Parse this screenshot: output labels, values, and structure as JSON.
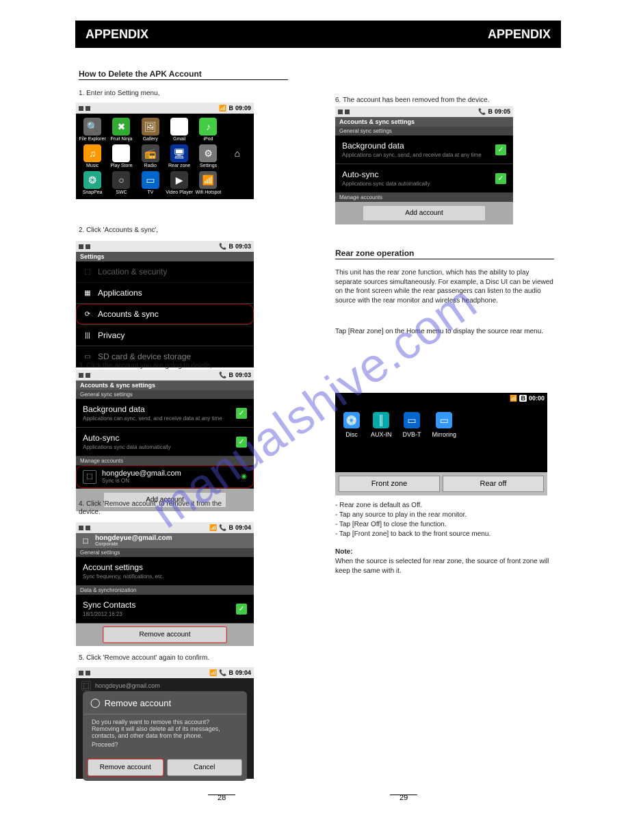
{
  "header": {
    "left_label": "APPENDIX",
    "right_label": "APPENDIX"
  },
  "section1": {
    "title": "How to Delete the APK Account",
    "step1": "1. Enter into Setting menu,"
  },
  "watermark": "manualshive.com",
  "status": {
    "time1": "09:09",
    "time2": "09:03",
    "time3": "09:03",
    "time4": "09:04",
    "time5": "09:04",
    "time6": "09:05",
    "time7": "00:00",
    "bt": "B"
  },
  "apps": [
    {
      "name": "file-explorer",
      "label": "File Explorer",
      "bg": "#666",
      "glyph": "🔍"
    },
    {
      "name": "fruit-ninja",
      "label": "Fruit Ninja",
      "bg": "#3a3",
      "glyph": "✖"
    },
    {
      "name": "gallery",
      "label": "Gallery",
      "bg": "#863",
      "glyph": "🖼"
    },
    {
      "name": "gmail",
      "label": "Gmail",
      "bg": "#fff",
      "glyph": "M"
    },
    {
      "name": "ipod",
      "label": "iPod",
      "bg": "#4c4",
      "glyph": "♪"
    },
    {
      "name": "blank1",
      "label": "",
      "bg": "transparent",
      "glyph": ""
    },
    {
      "name": "music",
      "label": "Music",
      "bg": "#f90",
      "glyph": "♫"
    },
    {
      "name": "play-store",
      "label": "Play Store",
      "bg": "#fff",
      "glyph": "▶"
    },
    {
      "name": "radio",
      "label": "Radio",
      "bg": "#444",
      "glyph": "📻"
    },
    {
      "name": "rear-zone",
      "label": "Rear zone",
      "bg": "#039",
      "glyph": "🖥"
    },
    {
      "name": "settings",
      "label": "Settings",
      "bg": "#777",
      "glyph": "⚙"
    },
    {
      "name": "home",
      "label": "",
      "bg": "transparent",
      "glyph": "⌂",
      "color": "#fff"
    },
    {
      "name": "snappea",
      "label": "SnapPea",
      "bg": "#2a8",
      "glyph": "❂"
    },
    {
      "name": "swc",
      "label": "SWC",
      "bg": "#333",
      "glyph": "○"
    },
    {
      "name": "tv",
      "label": "TV",
      "bg": "#06c",
      "glyph": "▭"
    },
    {
      "name": "video-player",
      "label": "Video Player",
      "bg": "#333",
      "glyph": "▶"
    },
    {
      "name": "wifi-hotspot",
      "label": "Wifi Hotspot",
      "bg": "#555",
      "glyph": "📶"
    }
  ],
  "step2": "2. Click 'Accounts & sync',",
  "settings_screen": {
    "title": "Settings",
    "row_top": "Location & security",
    "row1": "Applications",
    "row2": "Accounts & sync",
    "row3": "Privacy",
    "row4": "SD card & device storage"
  },
  "step3": "3. Click the account you are going to delete,",
  "accounts": {
    "title": "Accounts & sync settings",
    "subtitle": "General sync settings",
    "row1": "Background data",
    "row1_sub": "Applications can sync, send, and receive data at any time",
    "row2": "Auto-sync",
    "row2_sub": "Applications sync data automatically",
    "manage": "Manage accounts",
    "email": "hongdeyue@gmail.com",
    "sync_on": "Sync is ON",
    "add": "Add account"
  },
  "step4a": "4. Click 'Remove account' to remove it from the",
  "step4b": "device.",
  "step5": "5. Click 'Remove account' again to confirm.",
  "account_detail": {
    "email": "hongdeyue@gmail.com",
    "type": "Corporate",
    "general": "General settings",
    "acct_settings": "Account settings",
    "acct_sub": "Sync frequency, notifications, etc.",
    "data_sync": "Data & synchronization",
    "sync_contacts": "Sync Contacts",
    "sync_date": "18/1/2012 16:23",
    "remove": "Remove account"
  },
  "dialog": {
    "title": "Remove account",
    "body1": "Do you really want to remove this account? Removing it will also delete all of its messages, contacts, and other data from the phone.",
    "body2": "Proceed?",
    "btn_remove": "Remove account",
    "btn_cancel": "Cancel"
  },
  "step6": "6. The account has been removed from the device.",
  "section2": {
    "title": "Rear zone operation",
    "p1": "This unit has the rear zone function, which has the ability to play separate sources simultaneously. For example, a Disc UI can be viewed on the front screen while the rear passengers can listen to the audio source with the rear monitor and wireless headphone.",
    "p2": "Tap [Rear zone] on the Home menu to display the source rear menu."
  },
  "rear": {
    "items": [
      {
        "label": "Disc",
        "bg": "#39f",
        "glyph": "💿"
      },
      {
        "label": "AUX-IN",
        "bg": "#0aa",
        "glyph": "║"
      },
      {
        "label": "DVB-T",
        "bg": "#06c",
        "glyph": "▭"
      },
      {
        "label": "Mirroring",
        "bg": "#39f",
        "glyph": "▭"
      }
    ],
    "front": "Front zone",
    "rear_off": "Rear off"
  },
  "rear_notes": {
    "n1": "- Rear zone is default as Off.",
    "n2": "- Tap any source to play in the rear monitor.",
    "n3": "- Tap [Rear Off] to close the function.",
    "n4": "- Tap [Front zone] to back to the front source menu.",
    "note_label": "Note:",
    "note_text": "When the source is selected for rear zone, the source of front zone will keep the same with it."
  },
  "page": {
    "left": "28",
    "right": "29"
  }
}
